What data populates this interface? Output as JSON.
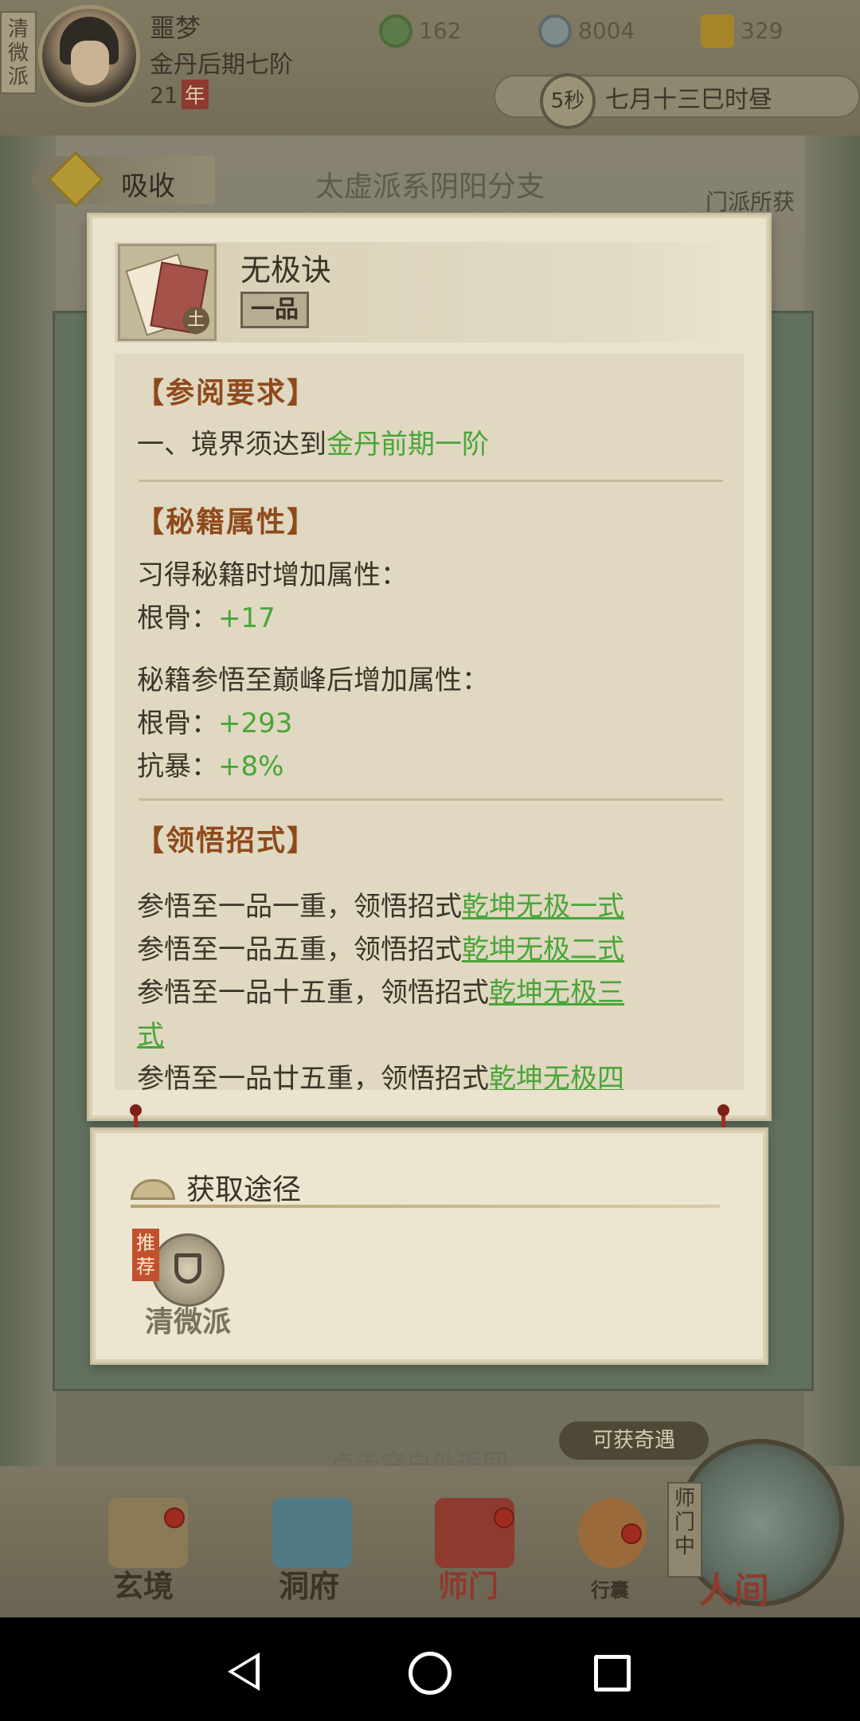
{
  "status": {
    "sect_tag": "清微派",
    "player_name": "噩梦",
    "realm": "金丹后期七阶",
    "age_value": "21",
    "age_unit": "年",
    "resources": [
      "162",
      "8004",
      "329"
    ],
    "timer": "5秒",
    "date": "七月十三巳时昼"
  },
  "background": {
    "absorb_label": "吸收",
    "title": "太虚派系阴阳分支",
    "side_text": "门派所获",
    "return_hint": "点击空白处返回",
    "adventure_label": "可获奇遇"
  },
  "book": {
    "element": "土",
    "name": "无极诀",
    "grade": "一品"
  },
  "requirements": {
    "title": "【参阅要求】",
    "prefix": "一、境界须达到",
    "realm": "金丹前期一阶"
  },
  "attributes": {
    "title": "【秘籍属性】",
    "learn_label": "习得秘籍时增加属性：",
    "learn_stats": [
      {
        "label": "根骨：",
        "value": "+17"
      }
    ],
    "peak_label": "秘籍参悟至巅峰后增加属性：",
    "peak_stats": [
      {
        "label": "根骨：",
        "value": "+293"
      },
      {
        "label": "抗暴：",
        "value": "+8%"
      }
    ]
  },
  "moves": {
    "title": "【领悟招式】",
    "items": [
      {
        "text": "参悟至一品一重，领悟招式",
        "link": "乾坤无极一式"
      },
      {
        "text": "参悟至一品五重，领悟招式",
        "link": "乾坤无极二式"
      },
      {
        "text": "参悟至一品十五重，领悟招式",
        "link": "乾坤无极三",
        "link_cont": "式"
      },
      {
        "text": "参悟至一品廿五重，领悟招式",
        "link": "乾坤无极四"
      }
    ]
  },
  "acquire": {
    "title": "获取途径",
    "badge": "推荐",
    "source": "清微派"
  },
  "nav": {
    "items": [
      "玄境",
      "洞府",
      "师门",
      "行囊",
      "人间"
    ],
    "shimen_tag": "师门中"
  }
}
